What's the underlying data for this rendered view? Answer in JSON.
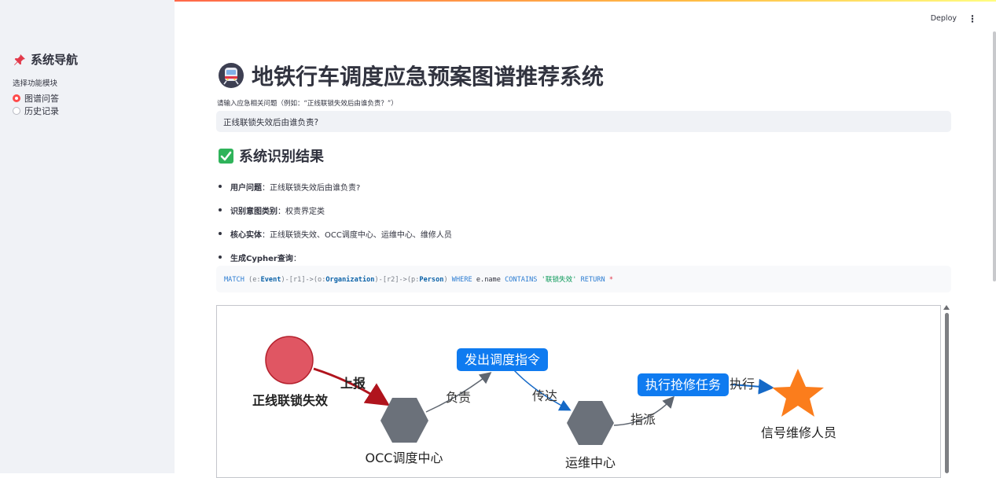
{
  "header": {
    "deploy_label": "Deploy",
    "menu_icon": "kebab-menu-icon"
  },
  "sidebar": {
    "title": "系统导航",
    "title_icon": "pushpin-icon",
    "radio_group_label": "选择功能模块",
    "options": [
      {
        "label": "图谱问答",
        "selected": true
      },
      {
        "label": "历史记录",
        "selected": false
      }
    ]
  },
  "main": {
    "title": "地铁行车调度应急预案图谱推荐系统",
    "title_icon": "metro-train-icon",
    "input_label": "请输入应急相关问题（例如：“正线联锁失效后由谁负责？”）",
    "input_value": "正线联锁失效后由谁负责?",
    "section_title": "系统识别结果",
    "section_icon": "check-mark-icon",
    "results": [
      {
        "key": "用户问题",
        "value": "：正线联锁失效后由谁负责?"
      },
      {
        "key": "识别意图类别",
        "value": "：权责界定类"
      },
      {
        "key": "核心实体",
        "value": "：正线联锁失效、OCC调度中心、运维中心、维修人员"
      },
      {
        "key": "生成Cypher查询",
        "value": "："
      }
    ],
    "cypher": {
      "match": "MATCH",
      "p1": " (e:",
      "event": "Event",
      "p2": ")-[r1]->(o:",
      "org": "Organization",
      "p3": ")-[r2]->(p:",
      "person": "Person",
      "p4": ") ",
      "where": "WHERE",
      "p5": " e.name ",
      "contains": "CONTAINS",
      "p6": " ",
      "str": "'联锁失效'",
      "p7": " ",
      "ret": "RETURN",
      "p8": " *"
    }
  },
  "graph": {
    "nodes": {
      "event": "正线联锁失效",
      "occ": "OCC调度中心",
      "ops": "运维中心",
      "worker": "信号维修人员"
    },
    "edge_labels": {
      "report": "上报",
      "responsible": "负责",
      "relay": "传达",
      "assign": "指派",
      "execute": "执行"
    },
    "boxes": {
      "dispatch": "发出调度指令",
      "repair": "执行抢修任务"
    },
    "colors": {
      "event_node": "#e05663",
      "org_node": "#6b717a",
      "worker_node": "#fb7d1c",
      "box": "#0f7bf0",
      "report_arrow": "#b0141d",
      "relay_arrow": "#1569c7"
    }
  }
}
